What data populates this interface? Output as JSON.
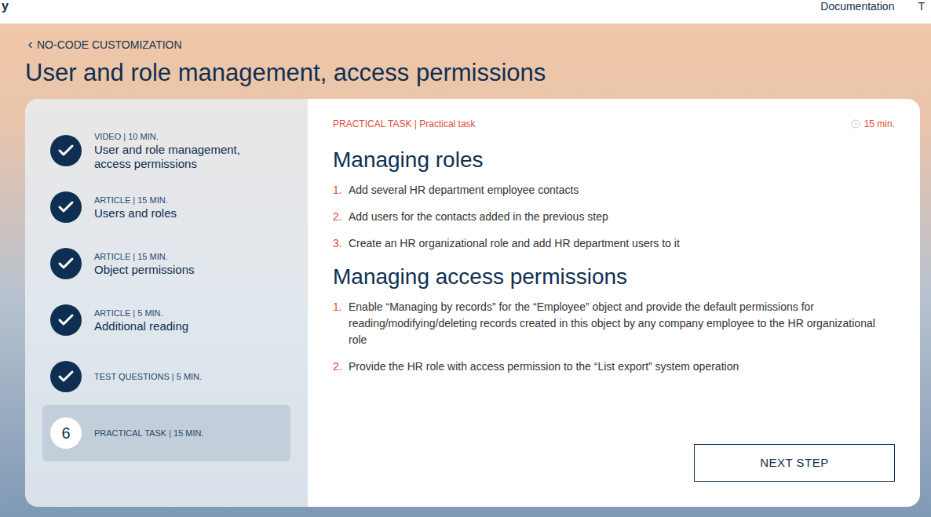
{
  "header": {
    "logo": "y",
    "links": [
      "Documentation",
      "T"
    ]
  },
  "breadcrumb": "NO-CODE CUSTOMIZATION",
  "title": "User and role management, access permissions",
  "steps": [
    {
      "type": "VIDEO | 10 MIN.",
      "title": "User and role management, access permissions",
      "completed": true,
      "selected": false
    },
    {
      "type": "ARTICLE | 15 MIN.",
      "title": "Users and roles",
      "completed": true,
      "selected": false
    },
    {
      "type": "ARTICLE | 15 MIN.",
      "title": "Object permissions",
      "completed": true,
      "selected": false
    },
    {
      "type": "ARTICLE | 5 MIN.",
      "title": "Additional reading",
      "completed": true,
      "selected": false
    },
    {
      "type": "TEST QUESTIONS | 5 MIN.",
      "completed": true,
      "selected": false
    },
    {
      "number": "6",
      "type": "PRACTICAL TASK | 15 MIN.",
      "completed": false,
      "selected": true
    }
  ],
  "task": {
    "label": "PRACTICAL TASK | Practical task",
    "duration": "15 min.",
    "sections": [
      {
        "heading": "Managing roles",
        "items": [
          {
            "number": "1.",
            "text": "Add several HR department employee contacts"
          },
          {
            "number": "2.",
            "text": "Add users for the contacts added in the previous step"
          },
          {
            "number": "3.",
            "text": "Create an HR organizational role and add HR department users to it"
          }
        ]
      },
      {
        "heading": "Managing access permissions",
        "items": [
          {
            "number": "1.",
            "text": "Enable “Managing by records” for the “Employee” object and provide the default permissions for reading/modifying/deleting records created in this object by any company employee to the HR organizational role"
          },
          {
            "number": "2.",
            "text": "Provide the HR role with access permission to the “List export” system operation"
          }
        ]
      }
    ]
  },
  "button": "NEXT STEP"
}
